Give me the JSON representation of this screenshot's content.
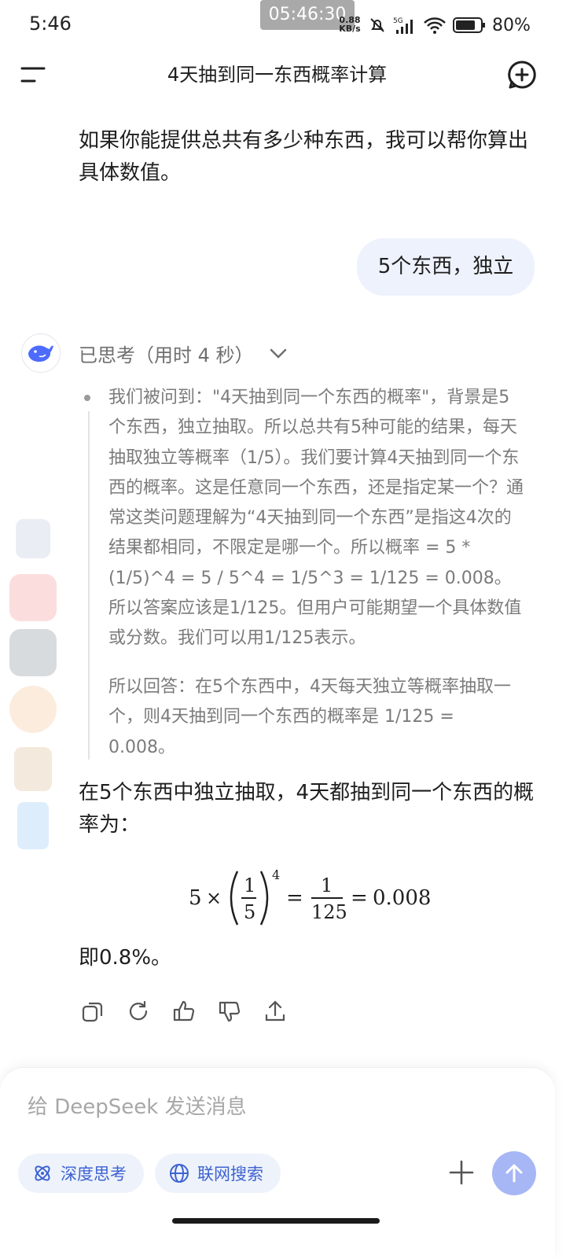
{
  "status": {
    "time": "5:46",
    "clock_overlay": "05:46:30",
    "net_speed_value": "0.88",
    "net_speed_unit": "KB/s",
    "battery": "80%"
  },
  "header": {
    "title": "4天抽到同一东西概率计算"
  },
  "messages": {
    "prev_reply": "如果你能提供总共有多少种东西，我可以帮你算出具体数值。",
    "user": "5个东西，独立",
    "thought_label": "已思考（用时 4 秒）",
    "thought_p1": "我们被问到：\"4天抽到同一个东西的概率\"，背景是5个东西，独立抽取。所以总共有5种可能的结果，每天抽取独立等概率（1/5）。我们要计算4天抽到同一个东西的概率。这是任意同一个东西，还是指定某一个？通常这类问题理解为“4天抽到同一个东西”是指这4次的结果都相同，不限定是哪一个。所以概率 = 5 * (1/5)^4 = 5 / 5^4 = 1/5^3 = 1/125 = 0.008。所以答案应该是1/125。但用户可能期望一个具体数值或分数。我们可以用1/125表示。",
    "thought_p2": "所以回答：在5个东西中，4天每天独立等概率抽取一个，则4天抽到同一个东西的概率是 1/125 = 0.008。",
    "answer_p1": "在5个东西中独立抽取，4天都抽到同一个东西的概率为：",
    "formula": {
      "coef": "5",
      "times": "×",
      "num": "1",
      "den": "5",
      "exp": "4",
      "eq": "=",
      "rhs_num": "1",
      "rhs_den": "125",
      "eq2": "=",
      "result": "0.008"
    },
    "answer_p2": "即0.8%。"
  },
  "actions": [
    "copy-icon",
    "regenerate-icon",
    "thumbs-up-icon",
    "thumbs-down-icon",
    "share-icon"
  ],
  "input": {
    "placeholder": "给 DeepSeek 发送消息",
    "deep_think": "深度思考",
    "web_search": "联网搜索"
  },
  "colors": {
    "accent": "#3d63d1",
    "chip_bg": "#eef2fb",
    "send_bg": "#a7b6f5",
    "user_bubble": "#eef2fc"
  }
}
